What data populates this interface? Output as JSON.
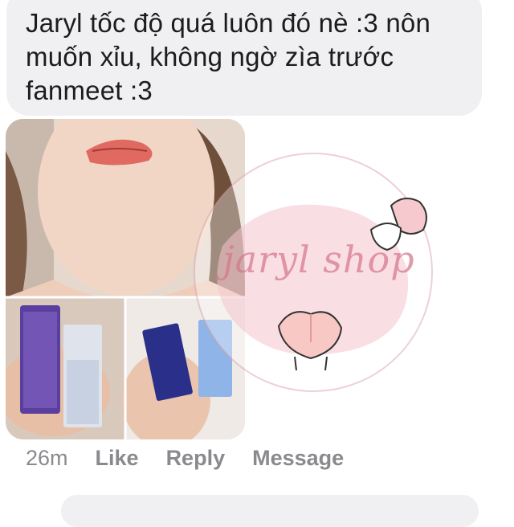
{
  "message": {
    "text": "Jaryl tốc độ quá luôn đó nè :3 nôn muốn xỉu, không ngờ zìa trước fanmeet :3"
  },
  "attachment": {
    "watermark": "jaryl shop"
  },
  "meta": {
    "timestamp": "26m",
    "like_label": "Like",
    "reply_label": "Reply",
    "message_label": "Message"
  }
}
